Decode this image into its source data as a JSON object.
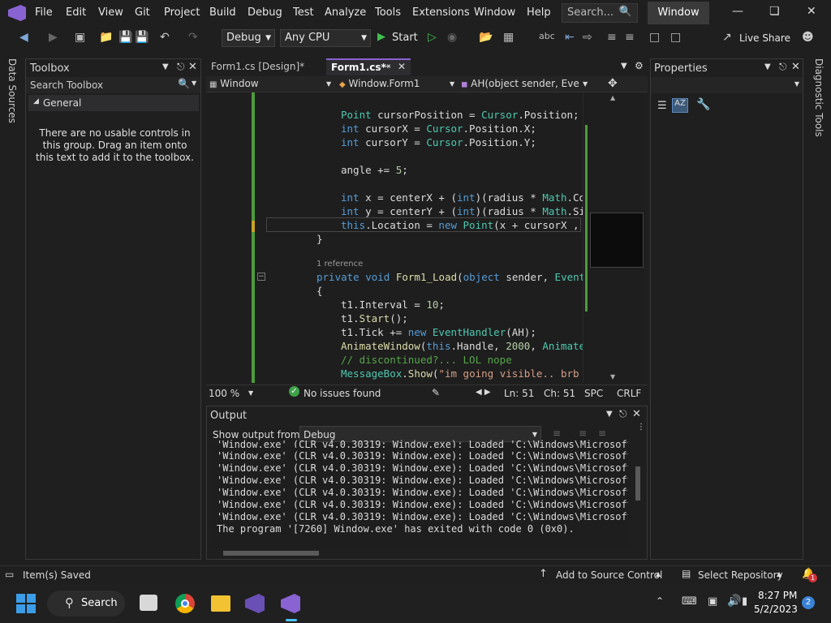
{
  "menu": [
    "File",
    "Edit",
    "View",
    "Git",
    "Project",
    "Build",
    "Debug",
    "Test",
    "Analyze",
    "Tools",
    "Extensions",
    "Window",
    "Help"
  ],
  "search_placeholder": "Search...",
  "window_title": "Window",
  "toolbar": {
    "config": "Debug",
    "platform": "Any CPU",
    "start": "Start",
    "live_share": "Live Share"
  },
  "left_vtab": "Data Sources",
  "right_vtab": "Diagnostic Tools",
  "toolbox": {
    "title": "Toolbox",
    "search": "Search Toolbox",
    "group": "General",
    "empty_msg": "There are no usable controls in this group. Drag an item onto this text to add it to the toolbox."
  },
  "tabs": [
    {
      "label": "Form1.cs [Design]*",
      "active": false
    },
    {
      "label": "Form1.cs*",
      "active": true
    }
  ],
  "nav": {
    "project": "Window",
    "class": "Window.Form1",
    "member": "AH(object sender, Eve"
  },
  "code_lines": [
    {
      "t": "Point cursorPosition = Cursor.Position;"
    },
    {
      "t": "int cursorX = Cursor.Position.X;"
    },
    {
      "t": "int cursorY = Cursor.Position.Y;"
    },
    {
      "t": "angle += 5;"
    },
    {
      "t": "int x = centerX + (int)(radius * Math.Co"
    },
    {
      "t": "int y = centerY + (int)(radius * Math.Si"
    },
    {
      "t": "this.Location = new Point(x + cursorX ,"
    },
    {
      "t": "}"
    },
    {
      "t": "1 reference"
    },
    {
      "t": "private void Form1_Load(object sender, Event"
    },
    {
      "t": "{"
    },
    {
      "t": "t1.Interval = 10;"
    },
    {
      "t": "t1.Start();"
    },
    {
      "t": "t1.Tick += new EventHandler(AH);"
    },
    {
      "t": "AnimateWindow(this.Handle, 2000, Animate"
    },
    {
      "t": "// discontinued?... LOL nope"
    },
    {
      "t": "MessageBox.Show(\"im going visible.. brb"
    }
  ],
  "editor_status": {
    "zoom": "100 %",
    "issues": "No issues found",
    "ln": "Ln: 51",
    "ch": "Ch: 51",
    "ws": "SPC",
    "eol": "CRLF"
  },
  "properties": {
    "title": "Properties"
  },
  "output": {
    "title": "Output",
    "show_from_label": "Show output from:",
    "source": "Debug",
    "lines": [
      "'Window.exe' (CLR v4.0.30319: Window.exe): Loaded 'C:\\Windows\\Microsoft.N",
      "'Window.exe' (CLR v4.0.30319: Window.exe): Loaded 'C:\\Windows\\Microsoft.N",
      "'Window.exe' (CLR v4.0.30319: Window.exe): Loaded 'C:\\Windows\\Microsoft.N",
      "'Window.exe' (CLR v4.0.30319: Window.exe): Loaded 'C:\\Windows\\Microsoft.N",
      "'Window.exe' (CLR v4.0.30319: Window.exe): Loaded 'C:\\Windows\\Microsoft.N",
      "'Window.exe' (CLR v4.0.30319: Window.exe): Loaded 'C:\\Windows\\Microsoft.N",
      "'Window.exe' (CLR v4.0.30319: Window.exe): Loaded 'C:\\Windows\\Microsoft.N",
      "The program '[7260] Window.exe' has exited with code 0 (0x0)."
    ]
  },
  "statusbar": {
    "left": "Item(s) Saved",
    "source_control": "Add to Source Control",
    "repo": "Select Repository",
    "notifications": "1"
  },
  "taskbar": {
    "search": "Search",
    "time": "8:27 PM",
    "date": "5/2/2023",
    "badge": "2"
  }
}
